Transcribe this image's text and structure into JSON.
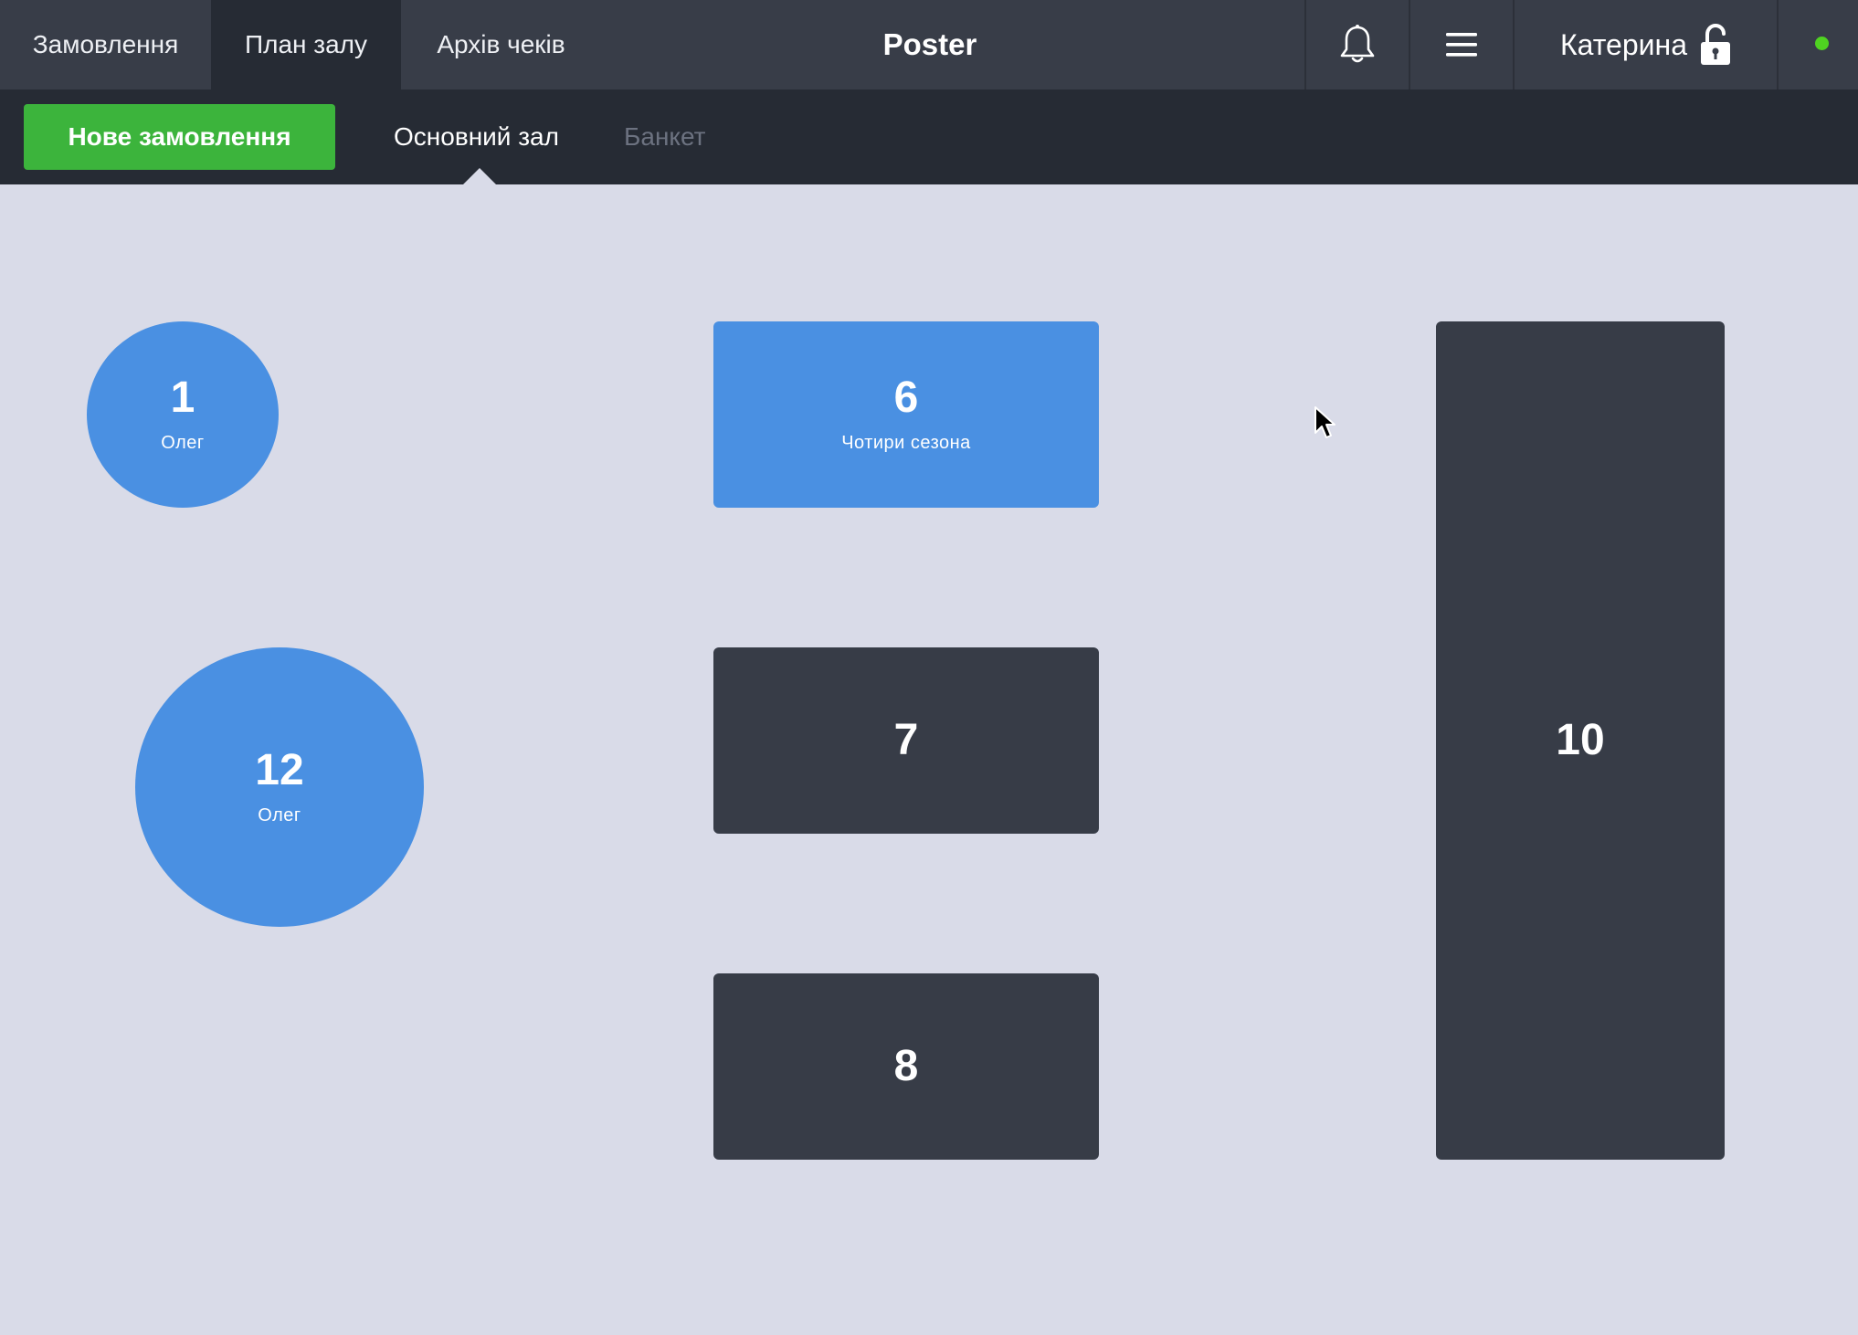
{
  "header": {
    "tabs": [
      {
        "label": "Замовлення"
      },
      {
        "label": "План залу"
      },
      {
        "label": "Архів чеків"
      }
    ],
    "brand": "Poster",
    "user": "Катерина",
    "icons": [
      "bell-icon",
      "menu-icon",
      "unlock-icon"
    ],
    "online_status_color": "#4fd321"
  },
  "subbar": {
    "new_order_label": "Нове замовлення",
    "halls": [
      {
        "label": "Основний зал",
        "active": true
      },
      {
        "label": "Банкет",
        "active": false
      }
    ]
  },
  "tables": [
    {
      "number": "1",
      "name": "Олег",
      "shape": "round",
      "status": "busy"
    },
    {
      "number": "12",
      "name": "Олег",
      "shape": "round",
      "status": "busy"
    },
    {
      "number": "6",
      "name": "Чотири сезона",
      "shape": "rect",
      "status": "busy"
    },
    {
      "number": "7",
      "name": "",
      "shape": "rect",
      "status": "free"
    },
    {
      "number": "8",
      "name": "",
      "shape": "rect",
      "status": "free"
    },
    {
      "number": "10",
      "name": "",
      "shape": "rect",
      "status": "free"
    }
  ],
  "colors": {
    "accent_green": "#3cb43c",
    "busy_blue": "#4a90e2",
    "free_dark": "#373c47",
    "floor_bg": "#d9dbe8"
  }
}
